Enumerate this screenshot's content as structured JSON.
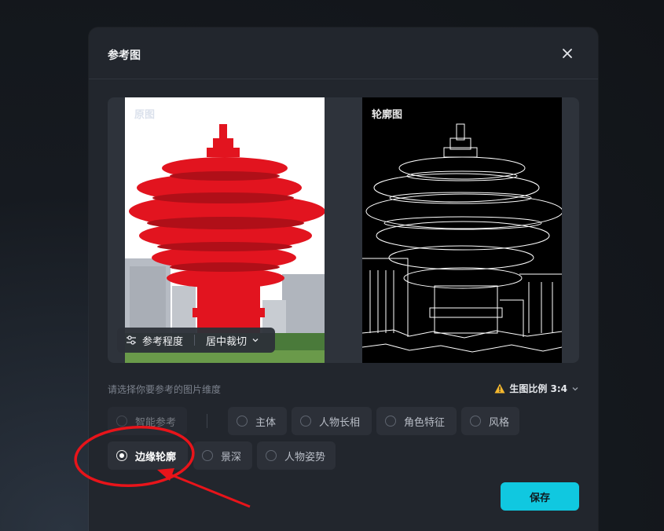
{
  "dialog": {
    "title": "参考图",
    "close_icon": "close-icon"
  },
  "preview": {
    "original_label": "原图",
    "edge_label": "轮廓图",
    "toolbar": {
      "icon": "sliders-icon",
      "reference_level_label": "参考程度",
      "crop_mode_label": "居中裁切",
      "crop_chevron": "chevron-down-icon"
    }
  },
  "dimensions": {
    "hint": "请选择你要参考的图片维度",
    "ratio_label": "生图比例 3:4",
    "ratio_icon": "warning-icon"
  },
  "options": [
    {
      "label": "智能参考",
      "selected": false
    },
    {
      "label": "主体",
      "selected": false
    },
    {
      "label": "人物长相",
      "selected": false
    },
    {
      "label": "角色特征",
      "selected": false
    },
    {
      "label": "风格",
      "selected": false
    },
    {
      "label": "边缘轮廓",
      "selected": true
    },
    {
      "label": "景深",
      "selected": false
    },
    {
      "label": "人物姿势",
      "selected": false
    }
  ],
  "save_label": "保存",
  "colors": {
    "accent": "#10c8e0",
    "annotation": "#e8141a",
    "dialog_bg": "#22262d"
  }
}
